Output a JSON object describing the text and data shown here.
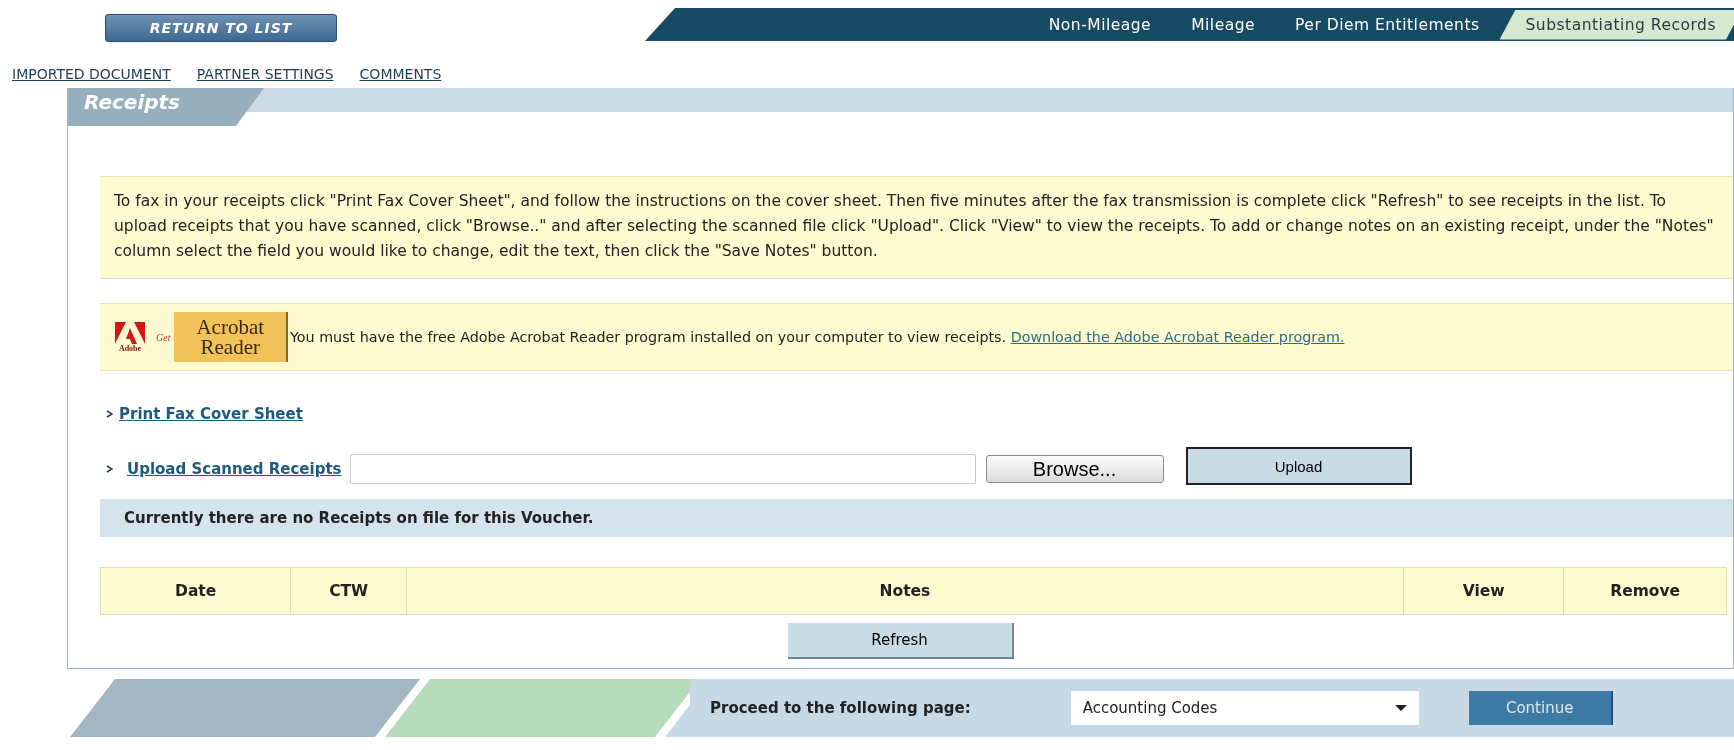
{
  "return_button": "RETURN TO LIST",
  "tabs": [
    {
      "label": "Non-Mileage",
      "selected": false
    },
    {
      "label": "Mileage",
      "selected": false
    },
    {
      "label": "Per Diem Entitlements",
      "selected": false
    },
    {
      "label": "Substantiating Records",
      "selected": true
    }
  ],
  "sub_links": [
    "IMPORTED DOCUMENT",
    "PARTNER SETTINGS",
    "COMMENTS"
  ],
  "panel": {
    "title": "Receipts",
    "instructions": "To fax in your receipts click \"Print Fax Cover Sheet\", and follow the instructions on the cover sheet. Then five minutes after the fax transmission is complete click \"Refresh\" to see receipts in the list. To upload receipts that you have scanned, click \"Browse..\" and after selecting the scanned file click \"Upload\". Click \"View\" to view the receipts. To add or change notes on an existing receipt, under the \"Notes\" column select the field you would like to change, edit the text, then click the \"Save Notes\" button.",
    "acrobat_badge": {
      "brand": "Adobe",
      "get": "Get",
      "line1": "Acrobat",
      "line2": "Reader"
    },
    "acrobat_notice": "You must have the free Adobe Acrobat Reader program installed on your computer to view receipts.",
    "acrobat_link": "Download the Adobe Acrobat Reader program.",
    "print_link": "Print Fax Cover Sheet",
    "upload_link": "Upload Scanned Receipts",
    "browse_button": "Browse...",
    "upload_button": "Upload",
    "message": "Currently there are no Receipts on file for this Voucher.",
    "columns": [
      "Date",
      "CTW",
      "Notes",
      "View",
      "Remove"
    ],
    "refresh_button": "Refresh"
  },
  "footer": {
    "label": "Proceed to the following page:",
    "select_value": "Accounting Codes",
    "continue_button": "Continue"
  }
}
